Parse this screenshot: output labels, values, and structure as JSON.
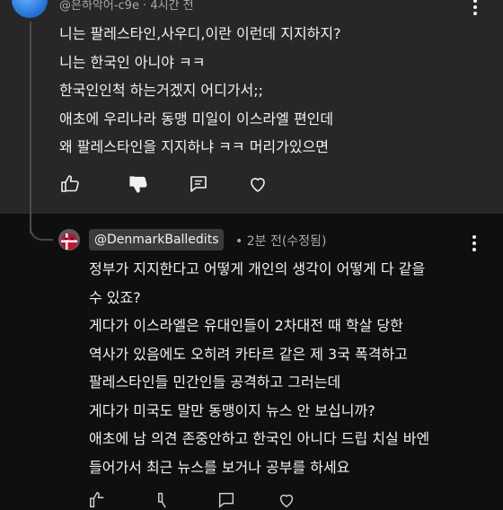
{
  "top_comment": {
    "handle": "@은하악어-c9e",
    "time": "4시간 전",
    "lines": [
      "니는 팔레스타인,사우디,이란 이런데 지지하지?",
      "니는 한국인 아니야 ㅋㅋ",
      "한국인인척 하는거겠지 어디가서;;",
      "애초에 우리나라 동맹 미일이 이스라엘 편인데",
      "왜 팔레스타인을 지지하냐 ㅋㅋ 머리가있으면"
    ]
  },
  "reply": {
    "handle": "@DenmarkBalledits",
    "meta": "2분 전(수정됨)",
    "lines": [
      "정부가 지지한다고 어떻게 개인의 생각이 어떻게 다 같을",
      "수 있죠?",
      "게다가 이스라엘은 유대인들이  2차대전 때 학살 당한",
      "역사가 있음에도 오히려 카타르 같은 제 3국 폭격하고",
      "팔레스타인들 민간인들 공격하고 그러는데",
      "게다가 미국도 말만 동맹이지 뉴스 안 보십니까?",
      "애초에 남 의견 존중안하고 한국인 아니다 드립 치실 바엔",
      "들어가서 최근 뉴스를 보거나 공부를 하세요"
    ]
  },
  "colors": {
    "top_bg": "#272727",
    "page_bg": "#0f0f0f",
    "text": "#f1f1f1",
    "meta_text": "#aaaaaa",
    "chip_bg": "#3b3b3b"
  },
  "icons": {
    "like": "thumbs-up-icon",
    "dislike": "thumbs-down-icon",
    "reply": "reply-comment-icon",
    "heart": "heart-icon",
    "menu": "more-vert-icon"
  }
}
